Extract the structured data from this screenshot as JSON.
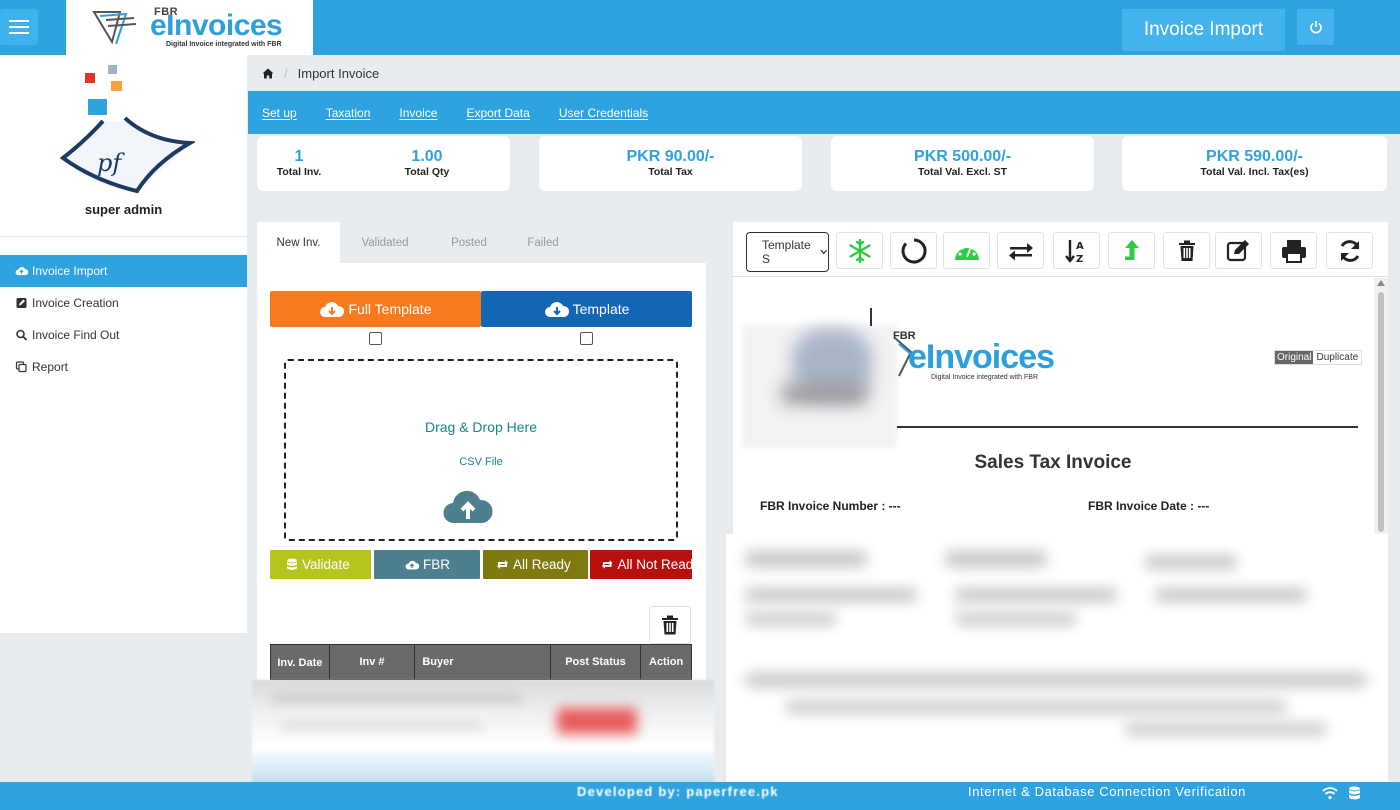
{
  "header": {
    "logo_small": "FBR",
    "logo_main": "eInvoices",
    "logo_tagline": "Digital Invoice integrated with FBR",
    "page_button": "Invoice Import"
  },
  "sidebar": {
    "avatar_text": "pf",
    "user_name": "super admin",
    "items": [
      {
        "label": "Invoice Import",
        "icon": "upload-cloud-icon",
        "active": true
      },
      {
        "label": "Invoice Creation",
        "icon": "edit-icon",
        "active": false
      },
      {
        "label": "Invoice Find Out",
        "icon": "search-icon",
        "active": false
      },
      {
        "label": "Report",
        "icon": "copy-icon",
        "active": false
      }
    ]
  },
  "breadcrumb": {
    "current": "Import Invoice"
  },
  "nav": [
    "Set up",
    "Taxation",
    "Invoice",
    "Export Data",
    "User Credentials"
  ],
  "stats": {
    "total_inv": {
      "value": "1",
      "label": "Total Inv."
    },
    "total_qty": {
      "value": "1.00",
      "label": "Total Qty"
    },
    "total_tax": {
      "value": "PKR 90.00/-",
      "label": "Total Tax"
    },
    "total_excl": {
      "value": "PKR 500.00/-",
      "label": "Total Val. Excl. ST"
    },
    "total_incl": {
      "value": "PKR 590.00/-",
      "label": "Total Val. Incl. Tax(es)"
    }
  },
  "tabs": [
    "New Inv.",
    "Validated",
    "Posted",
    "Failed"
  ],
  "upload": {
    "full_template": "Full Template",
    "template": "Template",
    "dropzone_title": "Drag & Drop Here",
    "dropzone_sub": "CSV File"
  },
  "actions": {
    "validate": "Validate",
    "fbr": "FBR",
    "all_ready": "All Ready",
    "all_not_ready": "All Not Ready"
  },
  "table": {
    "headers": [
      "Inv. Date",
      "Inv #",
      "Buyer",
      "Post Status",
      "Action"
    ]
  },
  "preview": {
    "template_select": "Template S",
    "logo_small": "FBR",
    "logo_main": "eInvoices",
    "logo_tagline": "Digital Invoice integrated with FBR",
    "original": "Original",
    "duplicate": "Duplicate",
    "title": "Sales Tax Invoice",
    "invoice_number": "FBR Invoice Number : ---",
    "invoice_date": "FBR Invoice Date : ---"
  },
  "footer": {
    "developed_by": "Developed by: paperfree.pk",
    "connection": "Internet & Database Connection Verification"
  },
  "colors": {
    "primary": "#2ea3e0",
    "orange": "#f77a1f",
    "navy": "#1366b4",
    "olive": "#b6c51d",
    "teal": "#4e7f8e",
    "dark_olive": "#7f7a0f",
    "red": "#b7100f"
  }
}
